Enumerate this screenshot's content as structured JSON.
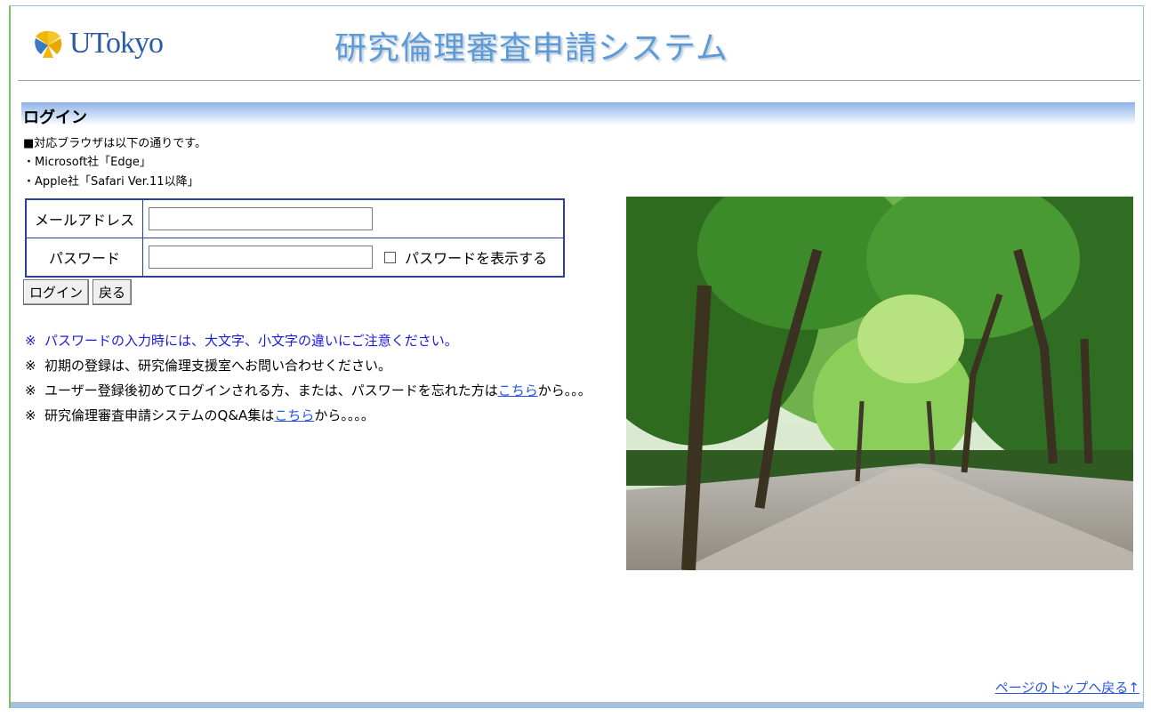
{
  "header": {
    "logo_text": "UTokyo",
    "system_title": "研究倫理審査申請システム"
  },
  "login": {
    "section_title": "ログイン",
    "browser_notes": [
      "■対応ブラウザは以下の通りです。",
      "・Microsoft社「Edge」",
      "・Apple社「Safari Ver.11以降」"
    ],
    "email_label": "メールアドレス",
    "email_value": "",
    "password_label": "パスワード",
    "password_value": "",
    "show_password_label": "パスワードを表示する",
    "show_password_checked": false,
    "login_button": "ログイン",
    "back_button": "戻る"
  },
  "notes": {
    "note1": "パスワードの入力時には、大文字、小文字の違いにご注意ください。",
    "note2": "初期の登録は、研究倫理支援室へお問い合わせください。",
    "note3_before": "ユーザー登録後初めてログインされる方、または、パスワードを忘れた方は",
    "note3_link": "こちら",
    "note3_after": "から。。。",
    "note4_before": "研究倫理審査申請システムのQ&A集は",
    "note4_link": "こちら",
    "note4_after": "から。。。。",
    "mark": "※"
  },
  "footer": {
    "top_link": "ページのトップへ戻る↑"
  },
  "colors": {
    "title": "#5d9ad6",
    "logo": "#2a5aa8",
    "note_blue": "#1a1adc",
    "link": "#2856d8",
    "table_border": "#2b3f9a"
  },
  "icons": {
    "logo": "ginkgo-leaf-icon"
  }
}
